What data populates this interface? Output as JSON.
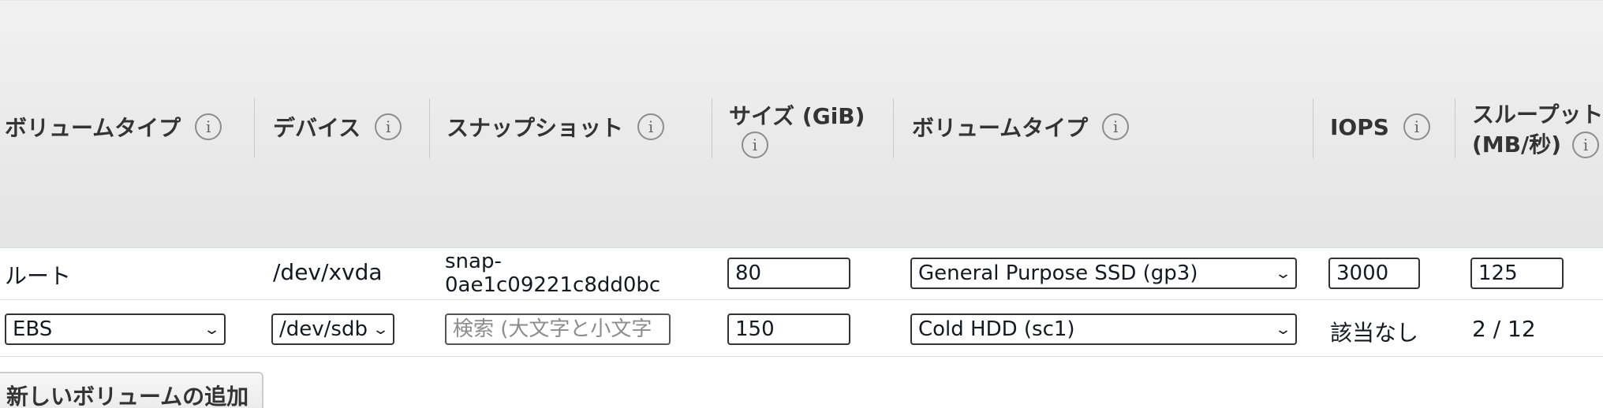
{
  "headers": {
    "volume_type": "ボリュームタイプ",
    "device": "デバイス",
    "snapshot": "スナップショット",
    "size_line1": "サイズ (GiB)",
    "ebs_volume_type": "ボリュームタイプ",
    "iops": "IOPS",
    "throughput_line1": "スループット",
    "throughput_line2": "(MB/秒)",
    "info_glyph": "i"
  },
  "rows": [
    {
      "volume_type": "ルート",
      "device": "/dev/xvda",
      "snapshot_line1": "snap-",
      "snapshot_line2": "0ae1c09221c8dd0bc",
      "size": "80",
      "ebs_volume_type": "General Purpose SSD (gp3)",
      "iops": "3000",
      "throughput": "125"
    },
    {
      "volume_type": "EBS",
      "device": "/dev/sdb",
      "snapshot_placeholder": "検索 (大文字と小文字",
      "size": "150",
      "ebs_volume_type": "Cold HDD (sc1)",
      "iops": "該当なし",
      "throughput": "2 / 12"
    }
  ],
  "add_volume_button": "新しいボリュームの追加",
  "icons": {
    "info": "info-circle-icon",
    "dropdown": "chevron-down-icon"
  },
  "colors": {
    "header_bg": "#e9e9e9",
    "text": "#16191f",
    "border": "#333333"
  }
}
